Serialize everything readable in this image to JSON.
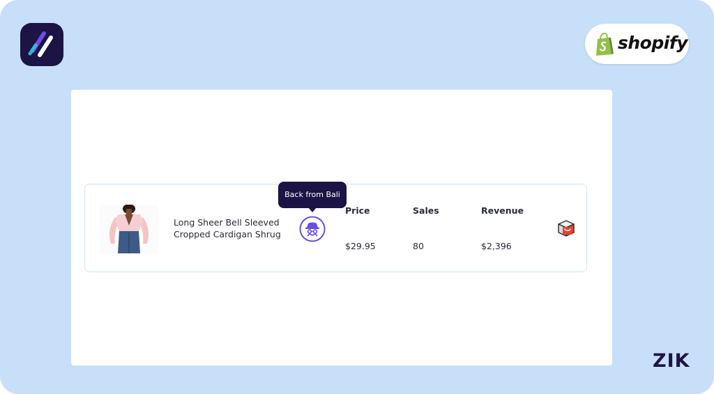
{
  "branding": {
    "app_logo_icon": "zik-slash-logo-icon",
    "shopify_label": "shopify",
    "shopify_icon": "shopify-bag-icon",
    "watermark": "ZIK"
  },
  "product": {
    "title": "Long Sheer Bell Sleeved Cropped Cardigan Shrug",
    "image_icon": "product-thumbnail",
    "tooltip": "Back from Bali",
    "spy_icon": "spy-icon",
    "action_icon": "aliexpress-box-icon",
    "columns": {
      "price_label": "Price",
      "sales_label": "Sales",
      "revenue_label": "Revenue"
    },
    "values": {
      "price": "$29.95",
      "sales": "80",
      "revenue": "$2,396"
    }
  },
  "colors": {
    "background": "#c8dffa",
    "brand_dark": "#1c1444",
    "accent_purple": "#6b4ce6",
    "shopify_green": "#95bf47"
  }
}
